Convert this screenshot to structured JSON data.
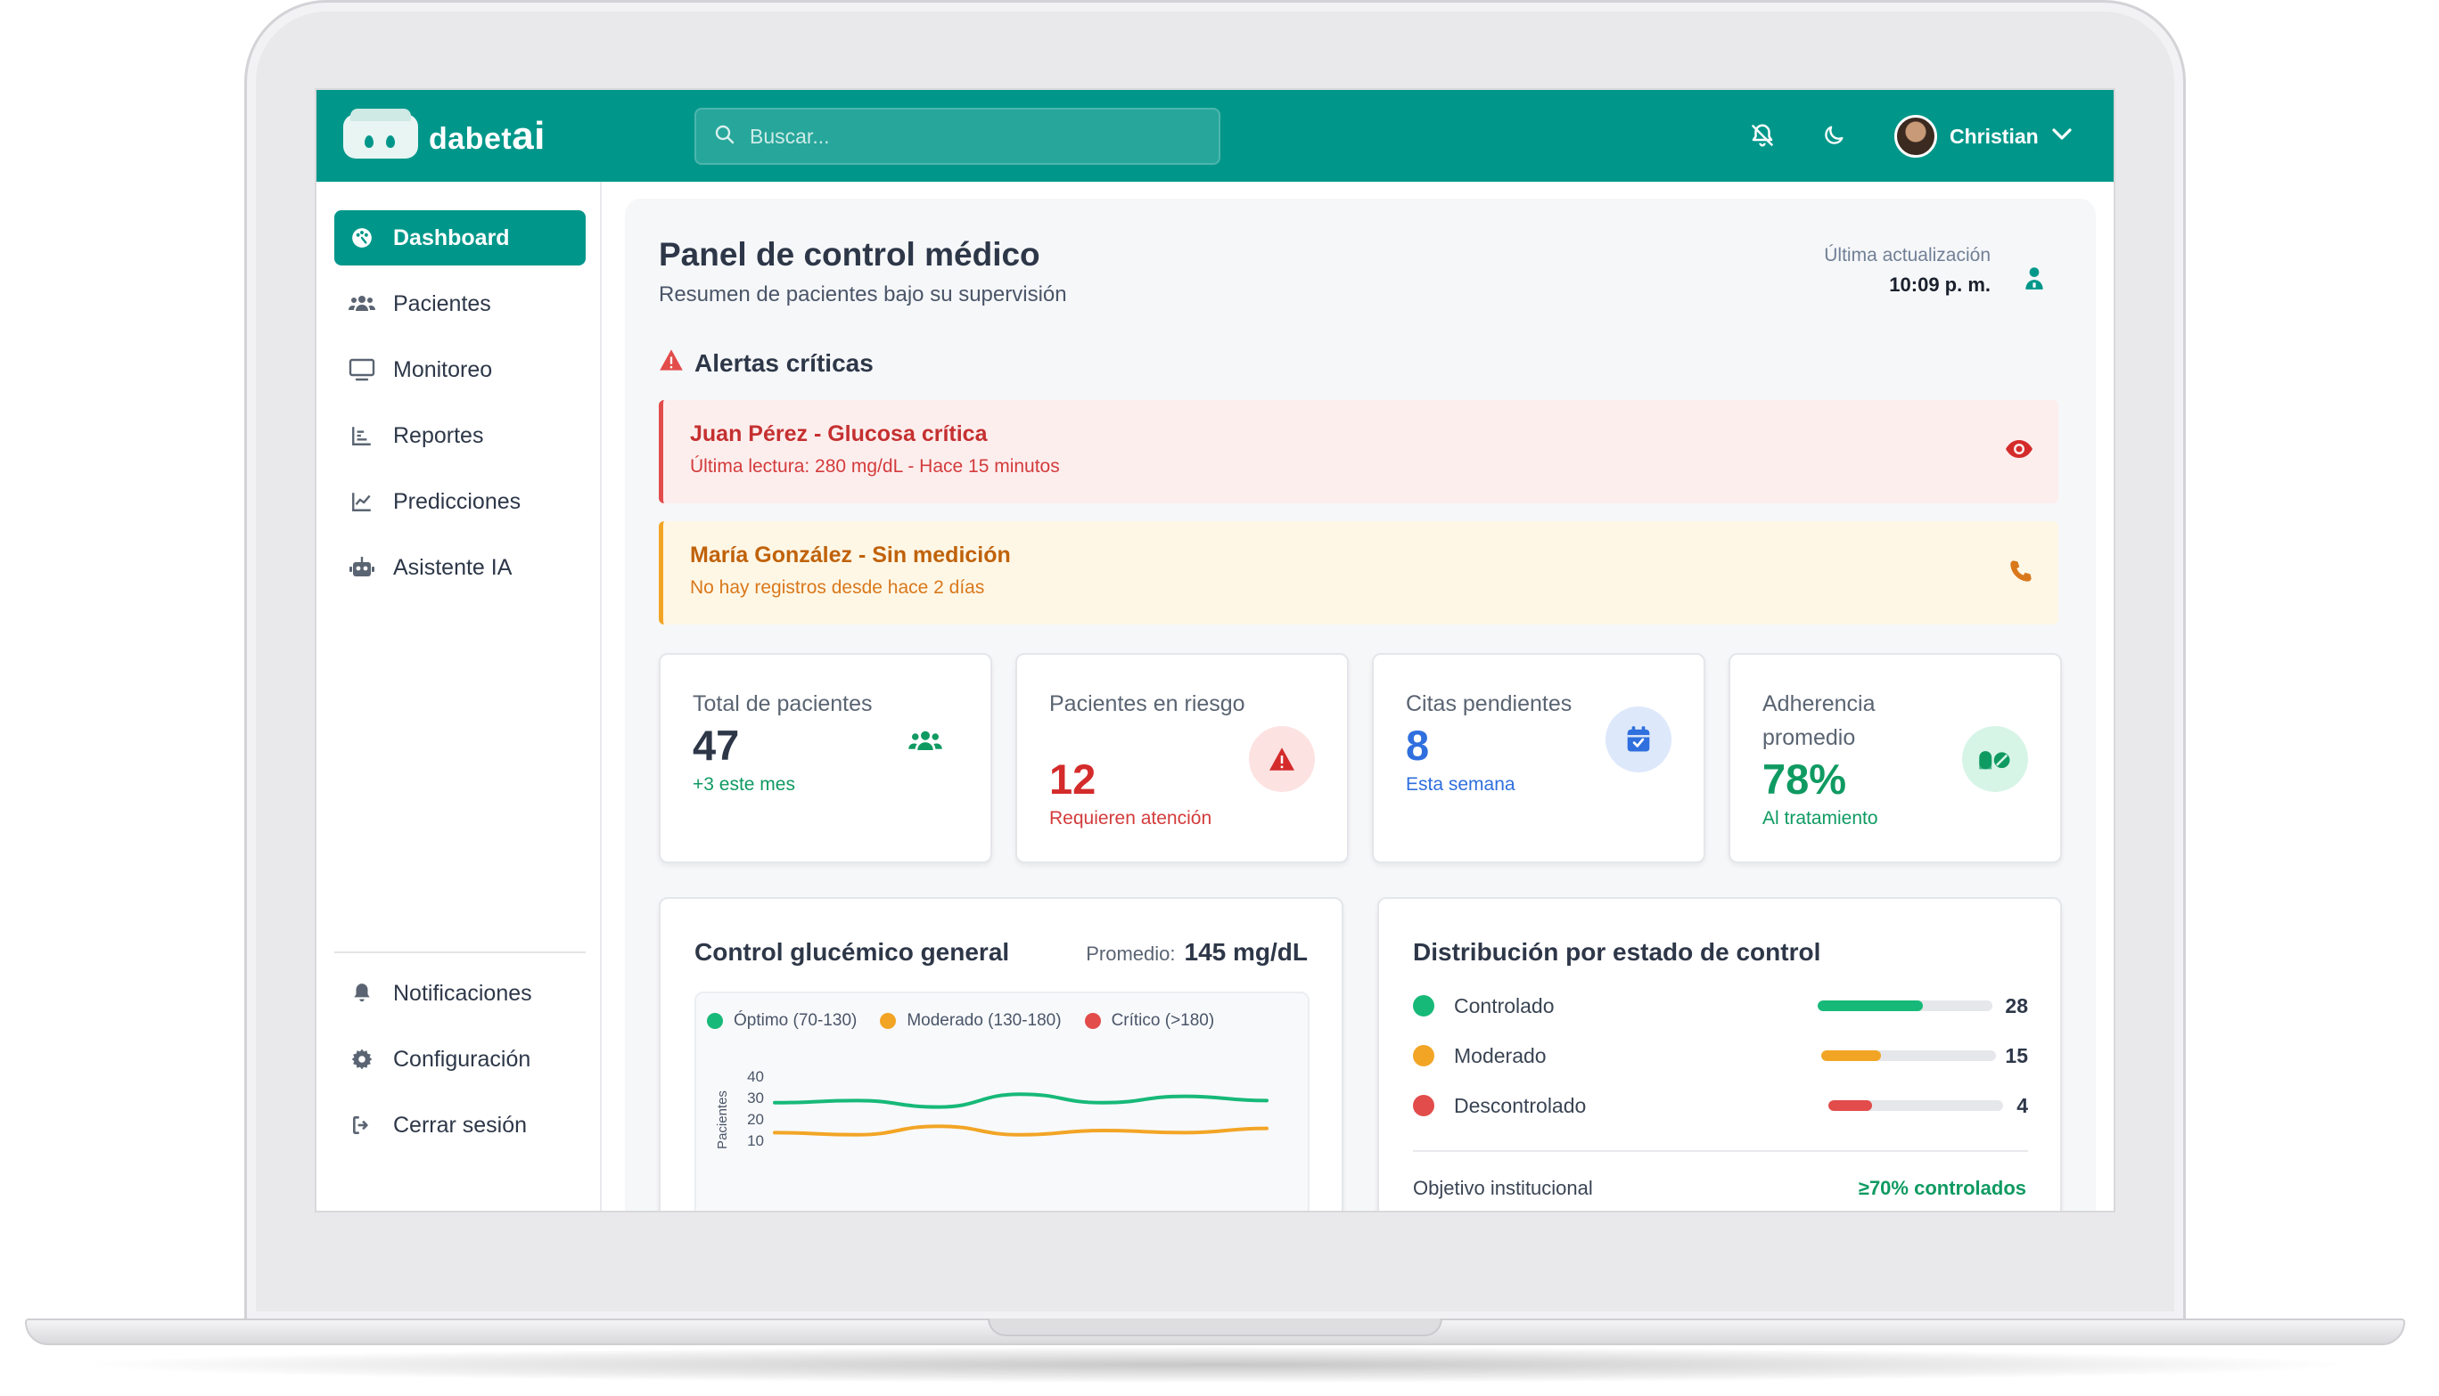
{
  "app": {
    "logo_text": "dabet",
    "logo_suffix": "ai"
  },
  "header": {
    "search_placeholder": "Buscar...",
    "user_name": "Christian"
  },
  "sidebar": {
    "items": [
      {
        "label": "Dashboard",
        "icon": "palette-icon",
        "active": true
      },
      {
        "label": "Pacientes",
        "icon": "users-icon"
      },
      {
        "label": "Monitoreo",
        "icon": "monitor-icon"
      },
      {
        "label": "Reportes",
        "icon": "bar-chart-icon"
      },
      {
        "label": "Predicciones",
        "icon": "line-chart-icon"
      },
      {
        "label": "Asistente IA",
        "icon": "robot-icon"
      }
    ],
    "bottom_items": [
      {
        "label": "Notificaciones",
        "icon": "bell-icon"
      },
      {
        "label": "Configuración",
        "icon": "gear-icon"
      },
      {
        "label": "Cerrar sesión",
        "icon": "logout-icon"
      }
    ]
  },
  "main": {
    "title": "Panel de control médico",
    "subtitle": "Resumen de pacientes bajo su supervisión",
    "update_label": "Última actualización",
    "update_time": "10:09 p. m.",
    "alerts_title": "Alertas críticas",
    "alerts": [
      {
        "title": "Juan Pérez - Glucosa crítica",
        "text": "Última lectura: 280 mg/dL - Hace 15 minutos",
        "action_icon": "eye-icon"
      },
      {
        "title": "María González - Sin medición",
        "text": "No hay registros desde hace 2 días",
        "action_icon": "phone-icon"
      }
    ],
    "stats": [
      {
        "label": "Total de pacientes",
        "value": "47",
        "note": "+3 este mes",
        "icon": "users-icon"
      },
      {
        "label": "Pacientes en riesgo",
        "value": "12",
        "note": "Requieren atención",
        "icon": "warning-icon"
      },
      {
        "label": "Citas pendientes",
        "value": "8",
        "note": "Esta semana",
        "icon": "calendar-check-icon"
      },
      {
        "label": "Adherencia promedio",
        "value": "78%",
        "note": "Al tratamiento",
        "icon": "pills-icon"
      }
    ],
    "glucose_card": {
      "title": "Control glucémico general",
      "avg_label": "Promedio:",
      "avg_value": "145 mg/dL"
    },
    "distribution_card": {
      "title": "Distribución por estado de control",
      "rows": [
        {
          "label": "Controlado",
          "count": "28",
          "fraction": 0.6,
          "color": "#17b978"
        },
        {
          "label": "Moderado",
          "count": "15",
          "fraction": 0.34,
          "color": "#f2a525"
        },
        {
          "label": "Descontrolado",
          "count": "4",
          "fraction": 0.25,
          "color": "#e24c4b"
        }
      ],
      "target_label": "Objetivo institucional",
      "target_value": "≥70% controlados"
    }
  },
  "chart_data": {
    "type": "line",
    "ylabel": "Pacientes",
    "yticks": [
      40,
      30,
      20,
      10
    ],
    "x": [
      0,
      1,
      2,
      3,
      4,
      5,
      6
    ],
    "series": [
      {
        "name": "Óptimo (70-130)",
        "color": "#17b978",
        "values": [
          28,
          29,
          26,
          32,
          28,
          31,
          29
        ]
      },
      {
        "name": "Moderado (130-180)",
        "color": "#f2a525",
        "values": [
          14,
          13,
          17,
          13,
          15,
          14,
          16
        ]
      },
      {
        "name": "Crítico (>180)",
        "color": "#e24c4b",
        "values": []
      }
    ]
  },
  "colors": {
    "brand": "#00978a",
    "danger": "#e24c4b",
    "warning": "#f2a525",
    "success": "#17b978",
    "info": "#2f6fde"
  }
}
